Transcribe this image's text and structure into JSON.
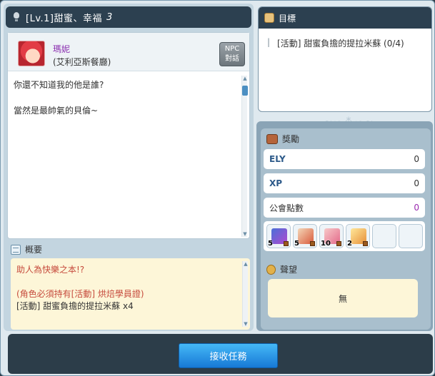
{
  "quest": {
    "title": "[Lv.1]甜蜜、幸福",
    "number": "3"
  },
  "npc": {
    "name": "瑪妮",
    "location": "(艾利亞斯餐廳)",
    "talk_button": "NPC\n對話",
    "talk_line1": "NPC",
    "talk_line2": "對話"
  },
  "dialog": {
    "lines": [
      "你還不知道我的他是誰?",
      "當然是最帥氣的貝倫~"
    ]
  },
  "summary": {
    "label": "概要",
    "line1": "助人為快樂之本!?",
    "line2": "(角色必須持有[活動] 烘焙學員證)",
    "line3": "[活動] 甜蜜負擔的提拉米蘇 x4"
  },
  "goal": {
    "label": "目標",
    "item": "[活動] 甜蜜負擔的提拉米蘇 (0/4)"
  },
  "reward": {
    "label": "獎勵",
    "rows": [
      {
        "label": "ELY",
        "value": "0"
      },
      {
        "label": "XP",
        "value": "0"
      },
      {
        "label": "公會點數",
        "value": "0"
      }
    ],
    "items": [
      {
        "qty": "5",
        "icon": "gift-box-icon"
      },
      {
        "qty": "5",
        "icon": "coupon-icon"
      },
      {
        "qty": "10",
        "icon": "ticket-icon"
      },
      {
        "qty": "2",
        "icon": "crystal-icon"
      }
    ]
  },
  "fame": {
    "label": "聲望",
    "value": "無"
  },
  "actions": {
    "accept": "接收任務"
  },
  "colors": {
    "header_bg": "#2c4050",
    "accept_button": "#2a9be8",
    "npc_name": "#8b2fb0",
    "summary_red": "#c64a3c"
  }
}
